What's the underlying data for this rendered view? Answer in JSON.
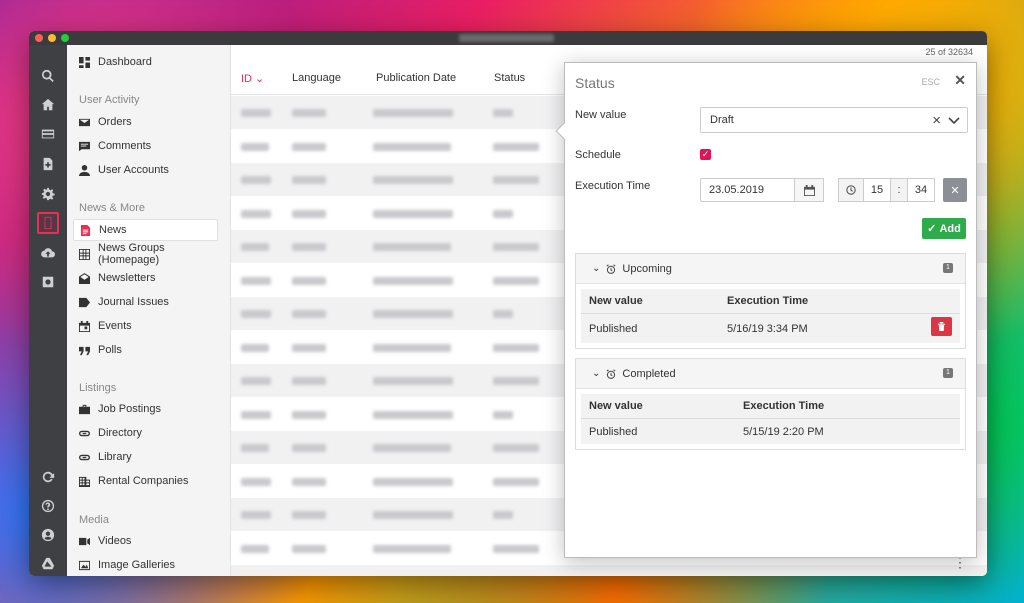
{
  "table": {
    "count": "25 of 32634",
    "columns": [
      "ID",
      "Language",
      "Publication Date",
      "Status"
    ]
  },
  "nav": {
    "top": [
      {
        "label": "Dashboard",
        "icon": "dashboard-icon"
      }
    ],
    "sections": [
      {
        "title": "User Activity",
        "items": [
          {
            "label": "Orders",
            "icon": "envelope-icon"
          },
          {
            "label": "Comments",
            "icon": "comment-icon"
          },
          {
            "label": "User Accounts",
            "icon": "user-icon"
          }
        ]
      },
      {
        "title": "News & More",
        "items": [
          {
            "label": "News",
            "icon": "document-icon"
          },
          {
            "label": "News Groups (Homepage)",
            "icon": "grid-icon"
          },
          {
            "label": "Newsletters",
            "icon": "open-envelope-icon"
          },
          {
            "label": "Journal Issues",
            "icon": "tag-icon"
          },
          {
            "label": "Events",
            "icon": "calendar-icon"
          },
          {
            "label": "Polls",
            "icon": "quote-icon"
          }
        ]
      },
      {
        "title": "Listings",
        "items": [
          {
            "label": "Job Postings",
            "icon": "briefcase-icon"
          },
          {
            "label": "Directory",
            "icon": "link-icon"
          },
          {
            "label": "Library",
            "icon": "link-icon"
          },
          {
            "label": "Rental Companies",
            "icon": "building-icon"
          }
        ]
      },
      {
        "title": "Media",
        "items": [
          {
            "label": "Videos",
            "icon": "video-icon"
          },
          {
            "label": "Image Galleries",
            "icon": "image-icon"
          }
        ]
      }
    ]
  },
  "modal": {
    "title": "Status",
    "esc": "ESC",
    "close": "✕",
    "new_value_label": "New value",
    "new_value": "Draft",
    "schedule_label": "Schedule",
    "schedule_checked": true,
    "execution_time_label": "Execution Time",
    "date": "23.05.2019",
    "hour": "15",
    "minute": "34",
    "time_separator": ":",
    "add_label": "Add",
    "upcoming": {
      "title": "Upcoming",
      "count": "1",
      "headers": [
        "New value",
        "Execution Time"
      ],
      "rows": [
        [
          "Published",
          "5/16/19 3:34 PM"
        ]
      ]
    },
    "completed": {
      "title": "Completed",
      "count": "1",
      "headers": [
        "New value",
        "Execution Time"
      ],
      "rows": [
        [
          "Published",
          "5/15/19 2:20 PM"
        ]
      ]
    }
  },
  "colors": {
    "accent": "#e53058",
    "add": "#2eab4a",
    "delete": "#dc3545",
    "rail": "#3f4044"
  }
}
